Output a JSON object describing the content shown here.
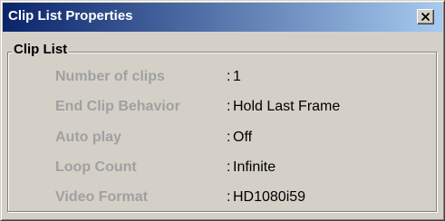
{
  "window": {
    "title": "Clip List Properties",
    "close_icon": "close-icon"
  },
  "group": {
    "label": "Clip List"
  },
  "separator": ":",
  "properties": [
    {
      "label": "Number of clips",
      "value": "1"
    },
    {
      "label": "End Clip Behavior",
      "value": "Hold Last Frame"
    },
    {
      "label": "Auto play",
      "value": "Off"
    },
    {
      "label": "Loop Count",
      "value": "Infinite"
    },
    {
      "label": "Video Format",
      "value": "HD1080i59"
    }
  ],
  "colors": {
    "title_gradient_start": "#0a246a",
    "title_gradient_end": "#a6caf0",
    "dialog_face": "#d4d0c8",
    "disabled_label": "#a0a0a0"
  }
}
